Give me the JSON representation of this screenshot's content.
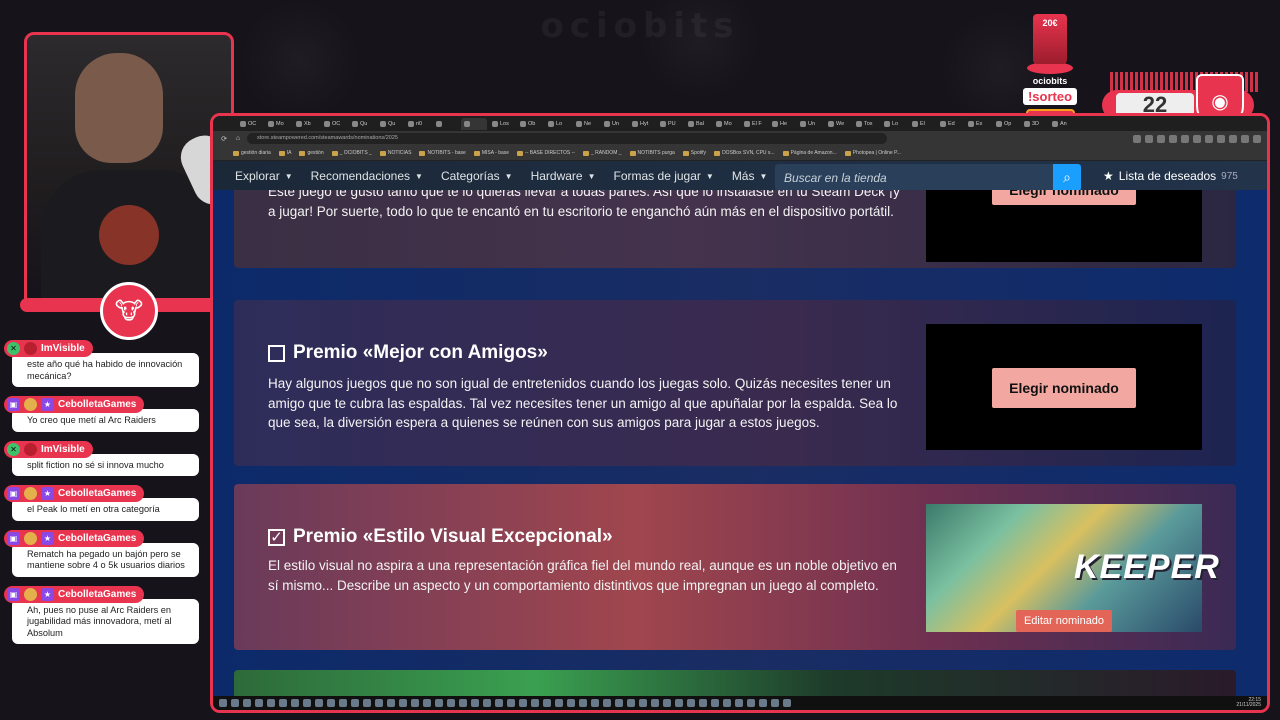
{
  "overlay": {
    "bg_logo": "ociobits",
    "giveaway": {
      "price": "20€",
      "brand": "ociobits",
      "command": "!sorteo",
      "sponsor": "GAMING",
      "counter": "22"
    }
  },
  "chat": [
    {
      "user": "ImVisible",
      "badge": "green",
      "text": "este año qué ha habido de innovación mecánica?"
    },
    {
      "user": "CebolletaGames",
      "badge": "purple",
      "text": "Yo creo que metí al Arc Raiders"
    },
    {
      "user": "ImVisible",
      "badge": "green",
      "text": "split fiction no sé si innova mucho"
    },
    {
      "user": "CebolletaGames",
      "badge": "purple",
      "text": "el Peak lo metí en otra categoría"
    },
    {
      "user": "CebolletaGames",
      "badge": "purple",
      "text": "Rematch ha pegado un bajón pero se mantiene sobre 4 o 5k usuarios diarios"
    },
    {
      "user": "CebolletaGames",
      "badge": "purple",
      "text": "Ah, pues no puse al Arc Raiders en jugabilidad más innovadora, metí al Absolum"
    }
  ],
  "browser": {
    "url": "store.steampowered.com/steamawards/nominations/2025",
    "tabs": [
      "OC",
      "Mo",
      "Xb",
      "OC",
      "Qu",
      "Qu",
      "ri0",
      "",
      "",
      "Los",
      "Ob",
      "Lo",
      "Ne",
      "Un",
      "Hyt",
      "PU",
      "Bal",
      "Mo",
      "El F",
      "He",
      "Un",
      "We",
      "Tox",
      "Lo",
      "El",
      "Ed",
      "Ex",
      "Op",
      "3D",
      "An"
    ],
    "bookmarks": [
      "gestión diaria",
      "IA",
      "gestión",
      "_ OCIOBITS _",
      "NOTICIAS",
      "NOTIBITS - base",
      "MISA - base",
      "-- BASE DIRECTOS --",
      "_ RANDOM _",
      "NOTIBITS purga",
      "Spotify",
      "DOSBox SVN, CPU s...",
      "Página de Amazon...",
      "Photopea | Online P..."
    ]
  },
  "steam_nav": {
    "items": [
      "Explorar",
      "Recomendaciones",
      "Categorías",
      "Hardware",
      "Formas de jugar",
      "Más"
    ],
    "search_placeholder": "Buscar en la tienda",
    "wishlist_label": "Lista de deseados",
    "wishlist_count": "975"
  },
  "awards": {
    "steam_deck": {
      "desc": "Este juego te gustó tanto que te lo quieras llevar a todas partes. Así que lo instalaste en tu Steam Deck ¡y a jugar! Por suerte, todo lo que te encantó en tu escritorio te enganchó aún más en el dispositivo portátil.",
      "button": "Elegir nominado"
    },
    "friends": {
      "title": "Premio «Mejor con Amigos»",
      "desc": "Hay algunos juegos que no son igual de entretenidos cuando los juegas solo. Quizás necesites tener un amigo que te cubra las espaldas. Tal vez necesites tener un amigo al que apuñalar por la espalda. Sea lo que sea, la diversión espera a quienes se reúnen con sus amigos para jugar a estos juegos.",
      "button": "Elegir nominado",
      "checked": false
    },
    "visual": {
      "title": "Premio «Estilo Visual Excepcional»",
      "desc": "El estilo visual no aspira a una representación gráfica fiel del mundo real, aunque es un noble objetivo en sí mismo... Describe un aspecto y un comportamiento distintivos que impregnan un juego al completo.",
      "nominee": "KEEPER",
      "button": "Editar nominado",
      "checked": true,
      "check_mark": "✓"
    }
  },
  "taskbar": {
    "time": "22:15",
    "date": "21/11/2025"
  },
  "colors": {
    "accent": "#e8344e",
    "steam_blue": "#1a9fff",
    "pick_button": "#f2a8a0",
    "edit_button": "#e36558"
  }
}
